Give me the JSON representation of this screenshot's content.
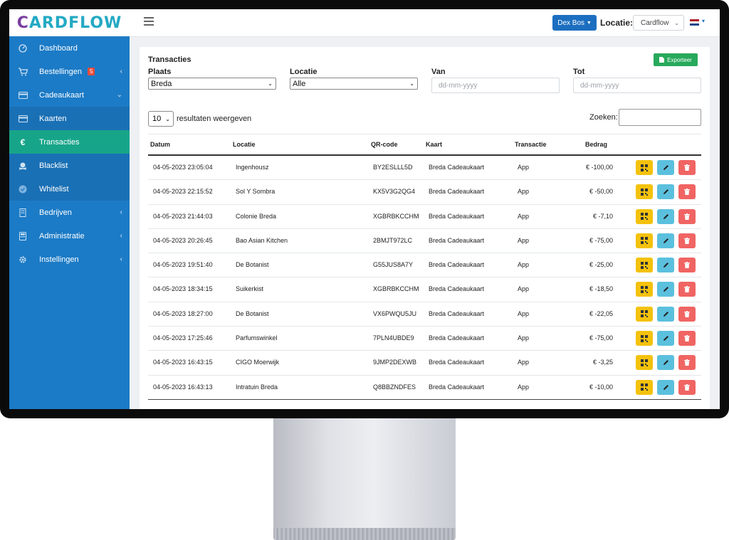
{
  "brand": {
    "logo_part1": "C",
    "logo_part2": "ARDFLOW"
  },
  "sidebar": {
    "items": [
      {
        "label": "Dashboard",
        "icon": "speedometer-icon"
      },
      {
        "label": "Bestellingen",
        "icon": "cart-icon",
        "badge": "5",
        "has_children": true
      },
      {
        "label": "Cadeaukaart",
        "icon": "card-icon",
        "has_children": true,
        "expanded": true
      },
      {
        "label": "Kaarten",
        "icon": "card-icon",
        "submenu": true
      },
      {
        "label": "Transacties",
        "icon": "euro-icon",
        "submenu": true,
        "active": true
      },
      {
        "label": "Blacklist",
        "icon": "skull-icon",
        "submenu": true
      },
      {
        "label": "Whitelist",
        "icon": "check-circle-icon",
        "submenu": true
      },
      {
        "label": "Bedrijven",
        "icon": "building-icon",
        "has_children": true
      },
      {
        "label": "Administratie",
        "icon": "calculator-icon",
        "has_children": true
      },
      {
        "label": "Instellingen",
        "icon": "gear-icon",
        "has_children": true
      }
    ]
  },
  "topbar": {
    "user": "Dex Bos",
    "location_label": "Locatie:",
    "location_value": "Cardflow",
    "language": "nl"
  },
  "card": {
    "title": "Transacties",
    "export_label": "Exporteer",
    "filters": {
      "plaats_label": "Plaats",
      "plaats_value": "Breda",
      "locatie_label": "Locatie",
      "locatie_value": "Alle",
      "van_label": "Van",
      "van_placeholder": "dd-mm-yyyy",
      "tot_label": "Tot",
      "tot_placeholder": "dd-mm-yyyy"
    },
    "length_value": "10",
    "length_text": "resultaten weergeven",
    "search_label": "Zoeken:"
  },
  "table": {
    "headers": [
      "Datum",
      "Locatie",
      "QR-code",
      "Kaart",
      "Transactie",
      "Bedrag"
    ],
    "rows": [
      [
        "04-05-2023 23:05:04",
        "Ingenhousz",
        "BY2ESLLL5D",
        "Breda Cadeaukaart",
        "App",
        "€ -100,00"
      ],
      [
        "04-05-2023 22:15:52",
        "Sol Y Sombra",
        "KX5V3G2QG4",
        "Breda Cadeaukaart",
        "App",
        "€ -50,00"
      ],
      [
        "04-05-2023 21:44:03",
        "Colonie Breda",
        "XGBRBKCCHM",
        "Breda Cadeaukaart",
        "App",
        "€ -7,10"
      ],
      [
        "04-05-2023 20:26:45",
        "Bao Asian Kitchen",
        "2BMJT972LC",
        "Breda Cadeaukaart",
        "App",
        "€ -75,00"
      ],
      [
        "04-05-2023 19:51:40",
        "De Botanist",
        "G55JUS8A7Y",
        "Breda Cadeaukaart",
        "App",
        "€ -25,00"
      ],
      [
        "04-05-2023 18:34:15",
        "Suikerkist",
        "XGBRBKCCHM",
        "Breda Cadeaukaart",
        "App",
        "€ -18,50"
      ],
      [
        "04-05-2023 18:27:00",
        "De Botanist",
        "VX6PWQU5JU",
        "Breda Cadeaukaart",
        "App",
        "€ -22,05"
      ],
      [
        "04-05-2023 17:25:46",
        "Parfumswinkel",
        "7PLN4UBDE9",
        "Breda Cadeaukaart",
        "App",
        "€ -75,00"
      ],
      [
        "04-05-2023 16:43:15",
        "CIGO Moerwijk",
        "9JMP2DEXWB",
        "Breda Cadeaukaart",
        "App",
        "€ -3,25"
      ],
      [
        "04-05-2023 16:43:13",
        "Intratuin Breda",
        "Q8BBZNDFES",
        "Breda Cadeaukaart",
        "App",
        "€ -10,00"
      ]
    ]
  },
  "colors": {
    "sidebar": "#1c7bc6",
    "active": "#17a589",
    "primary": "#1c6fc0",
    "export": "#27a95b",
    "qr": "#f4c20d",
    "edit": "#5bc0de",
    "delete": "#f06563"
  }
}
